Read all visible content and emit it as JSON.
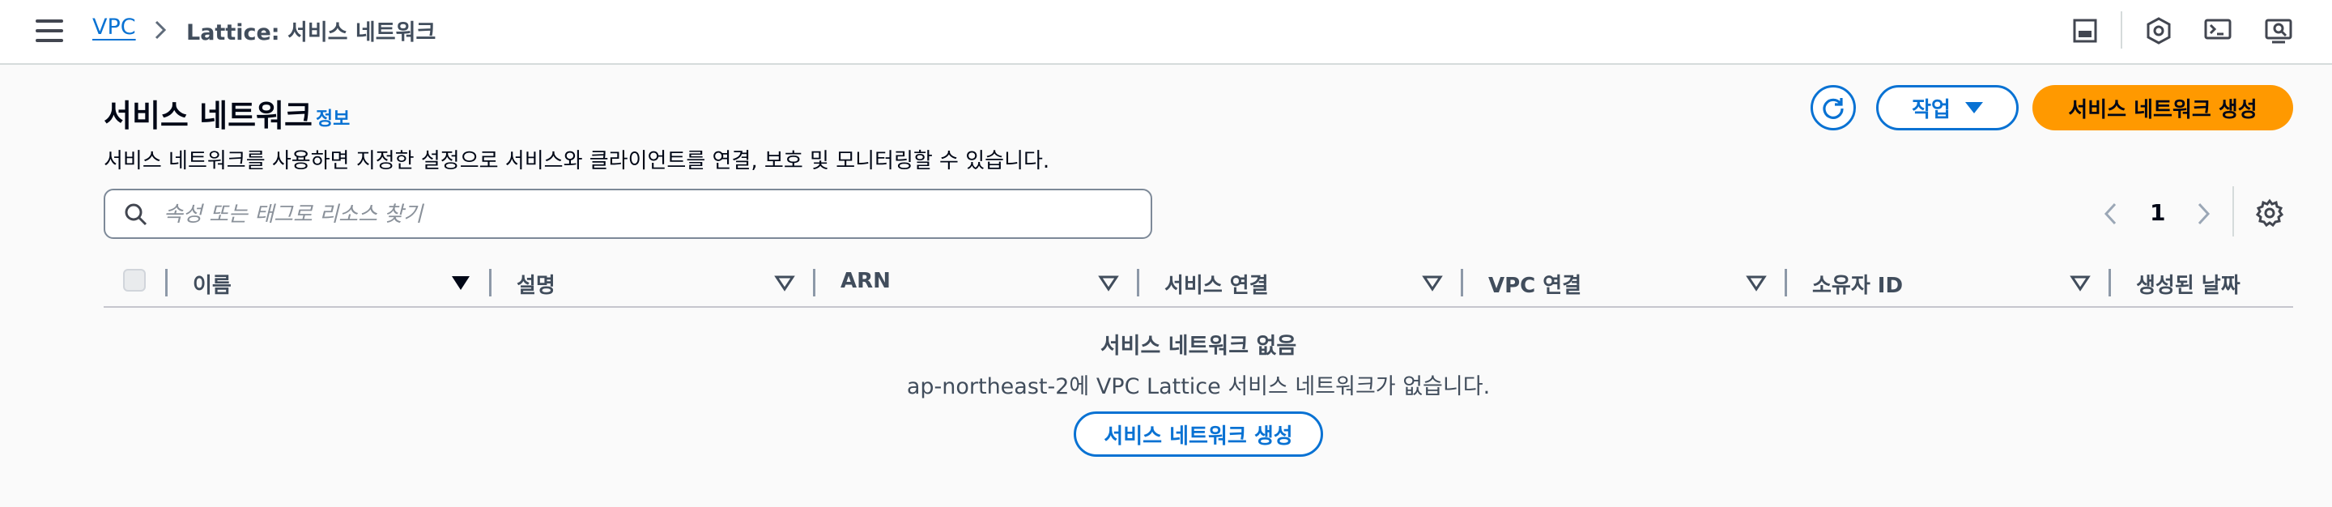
{
  "breadcrumb": {
    "parent": "VPC",
    "current": "Lattice: 서비스 네트워크"
  },
  "header": {
    "title": "서비스 네트워크",
    "info_label": "정보",
    "description": "서비스 네트워크를 사용하면 지정한 설정으로 서비스와 클라이언트를 연결, 보호 및 모니터링할 수 있습니다."
  },
  "actions": {
    "actions_label": "작업",
    "create_label": "서비스 네트워크 생성"
  },
  "search": {
    "placeholder": "속성 또는 태그로 리소스 찾기",
    "value": ""
  },
  "pagination": {
    "current_page": "1"
  },
  "table": {
    "columns": [
      "이름",
      "설명",
      "ARN",
      "서비스 연결",
      "VPC 연결",
      "소유자 ID",
      "생성된 날짜"
    ],
    "rows": []
  },
  "empty_state": {
    "title": "서비스 네트워크 없음",
    "description": "ap-northeast-2에 VPC Lattice 서비스 네트워크가 없습니다.",
    "button_label": "서비스 네트워크 생성"
  },
  "colors": {
    "accent": "#0972d3",
    "primary_button": "#ff9900",
    "text": "#000716",
    "muted_text": "#414d5c"
  },
  "icons": [
    "menu-icon",
    "chevron-right-icon",
    "panel-icon",
    "shield-icon",
    "cloudshell-icon",
    "screen-search-icon",
    "refresh-icon",
    "caret-down-icon",
    "search-icon",
    "chevron-left-icon",
    "settings-icon",
    "sort-icon"
  ]
}
